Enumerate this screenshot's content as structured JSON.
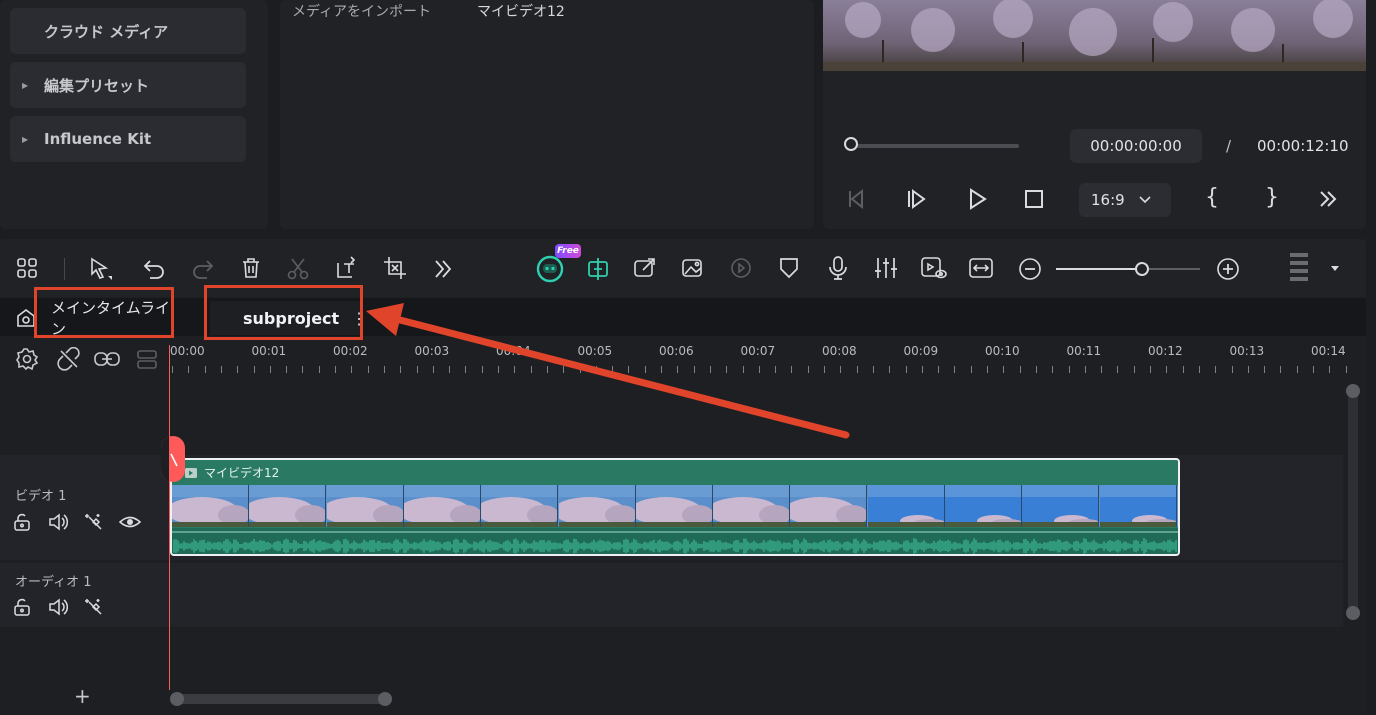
{
  "sidebar": {
    "items": [
      {
        "label": "クラウド メディア",
        "has_arrow": false
      },
      {
        "label": "編集プリセット",
        "has_arrow": true
      },
      {
        "label": "Influence Kit",
        "has_arrow": true
      }
    ]
  },
  "media": {
    "import_label": "メディアをインポート",
    "file_name": "マイビデオ12"
  },
  "player": {
    "current_time": "00:00:00:00",
    "separator": "/",
    "total_time": "00:00:12:10",
    "aspect_ratio": "16:9",
    "progress": 0.0
  },
  "toolbar": {
    "badge_free": "Free"
  },
  "tabs": {
    "main": "メインタイムライン",
    "sub": "subproject"
  },
  "ruler": {
    "labels": [
      "00:00",
      "00:01",
      "00:02",
      "00:03",
      "00:04",
      "00:05",
      "00:06",
      "00:07",
      "00:08",
      "00:09",
      "00:10",
      "00:11",
      "00:12",
      "00:13",
      "00:14"
    ]
  },
  "tracks": {
    "video": "ビデオ 1",
    "audio": "オーディオ 1"
  },
  "clip": {
    "name": "マイビデオ12"
  },
  "colors": {
    "accent": "#2fd0b0",
    "clip_header": "#2a7a63",
    "playhead": "#ff5a5a",
    "annotation": "#e0442a"
  }
}
